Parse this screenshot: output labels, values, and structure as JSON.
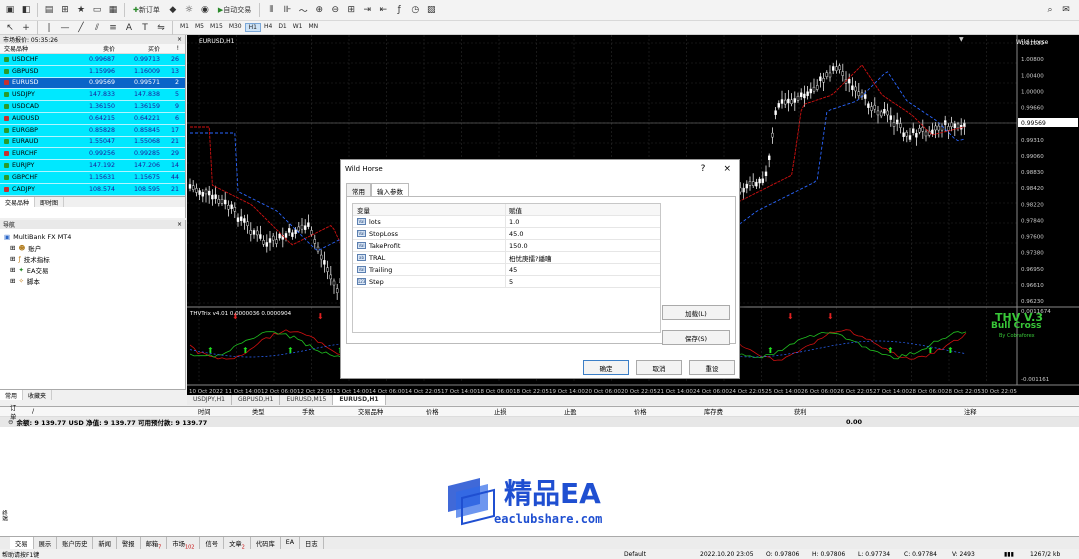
{
  "toolbar": {
    "new_order": "新订单",
    "auto_trade": "自动交易",
    "timeframes": [
      "M1",
      "M5",
      "M15",
      "M30",
      "H1",
      "H4",
      "D1",
      "W1",
      "MN"
    ],
    "active_tf": "H1"
  },
  "market_watch": {
    "title": "市场报价: 05:35:26",
    "headers": {
      "symbol": "交易品种",
      "bid": "卖价",
      "ask": "买价",
      "spread": "!"
    },
    "rows": [
      {
        "symbol": "USDCHF",
        "bid": "0.99687",
        "ask": "0.99713",
        "spread": "26"
      },
      {
        "symbol": "GBPUSD",
        "bid": "1.15996",
        "ask": "1.16009",
        "spread": "13"
      },
      {
        "symbol": "EURUSD",
        "bid": "0.99569",
        "ask": "0.99571",
        "spread": "2"
      },
      {
        "symbol": "USDJPY",
        "bid": "147.833",
        "ask": "147.838",
        "spread": "5"
      },
      {
        "symbol": "USDCAD",
        "bid": "1.36150",
        "ask": "1.36159",
        "spread": "9"
      },
      {
        "symbol": "AUDUSD",
        "bid": "0.64215",
        "ask": "0.64221",
        "spread": "6"
      },
      {
        "symbol": "EURGBP",
        "bid": "0.85828",
        "ask": "0.85845",
        "spread": "17"
      },
      {
        "symbol": "EURAUD",
        "bid": "1.55047",
        "ask": "1.55068",
        "spread": "21"
      },
      {
        "symbol": "EURCHF",
        "bid": "0.99256",
        "ask": "0.99285",
        "spread": "29"
      },
      {
        "symbol": "EURJPY",
        "bid": "147.192",
        "ask": "147.206",
        "spread": "14"
      },
      {
        "symbol": "GBPCHF",
        "bid": "1.15631",
        "ask": "1.15675",
        "spread": "44"
      },
      {
        "symbol": "CADJPY",
        "bid": "108.574",
        "ask": "108.595",
        "spread": "21"
      }
    ],
    "tabs": [
      "交易品种",
      "即时图"
    ]
  },
  "navigator": {
    "title": "导航",
    "root": "MultiBank FX MT4",
    "items": [
      "账户",
      "技术指标",
      "EA交易",
      "脚本"
    ],
    "tabs": [
      "常用",
      "收藏夹"
    ]
  },
  "chart": {
    "symbol_label": "EURUSD,H1",
    "ea_label": "Wild Horse",
    "indicator_label": "THVTrix v4.01 0.0000036 0.0000904",
    "overlay_title": "THV V.3",
    "overlay_sub": "Bull Cross",
    "overlay_brand": "By Cobraforex",
    "price_scale": [
      "1.01030",
      "1.00800",
      "1.00400",
      "1.00000",
      "0.99660",
      "0.99569",
      "0.99310",
      "0.99060",
      "0.98830",
      "0.98420",
      "0.98220",
      "0.97840",
      "0.97600",
      "0.97380",
      "0.96950",
      "0.96610",
      "0.96230"
    ],
    "current_price": "0.99569",
    "ind_scale": [
      "0.0011674",
      "-0.001161"
    ],
    "time_scale": [
      "10 Oct 2022",
      "11 Oct 14:00",
      "12 Oct 06:00",
      "12 Oct 22:05",
      "13 Oct 14:00",
      "14 Oct 06:00",
      "14 Oct 22:05",
      "17 Oct 14:00",
      "18 Oct 06:00",
      "18 Oct 22:05",
      "19 Oct 14:00",
      "20 Oct 06:00",
      "20 Oct 22:05",
      "21 Oct 14:00",
      "24 Oct 06:00",
      "24 Oct 22:05",
      "25 Oct 14:00",
      "26 Oct 06:00",
      "26 Oct 22:05",
      "27 Oct 14:00",
      "28 Oct 06:00",
      "28 Oct 22:05",
      "30 Oct 22:05"
    ],
    "tabs": [
      "USDJPY,H1",
      "GBPUSD,H1",
      "EURUSD,M15",
      "EURUSD,H1"
    ]
  },
  "dialog": {
    "title": "Wild Horse",
    "help": "?",
    "close": "×",
    "tabs": [
      "常用",
      "输入参数"
    ],
    "col_var": "变量",
    "col_val": "赋值",
    "params": [
      {
        "name": "lots",
        "value": "1.0",
        "icon": "Val"
      },
      {
        "name": "StopLoss",
        "value": "45.0",
        "icon": "Val"
      },
      {
        "name": "TakeProfit",
        "value": "150.0",
        "icon": "Val"
      },
      {
        "name": "TRAL",
        "value": "桕忧庚擂?繙嘈",
        "icon": "ab"
      },
      {
        "name": "Trailing",
        "value": "45",
        "icon": "Val"
      },
      {
        "name": "Step",
        "value": "5",
        "icon": "123"
      }
    ],
    "load": "加载(L)",
    "save": "保存(S)",
    "ok": "确定",
    "cancel": "取消",
    "reset": "重设"
  },
  "terminal": {
    "headers": [
      "订单",
      "/",
      "时间",
      "类型",
      "手数",
      "交易品种",
      "价格",
      "止损",
      "止盈",
      "价格",
      "库存费",
      "获利",
      "注释"
    ],
    "balance": "余额: 9 139.77 USD  净值: 9 139.77  可用预付款: 9 139.77",
    "profit": "0.00",
    "tabs": [
      "交易",
      "展示",
      "账户历史",
      "新闻",
      "警报",
      "邮箱",
      "市场",
      "信号",
      "文章",
      "代码库",
      "EA",
      "日志"
    ],
    "badges": {
      "邮箱": "7",
      "市场": "102",
      "文章": "2"
    },
    "side_label": "终端"
  },
  "status": {
    "help": "帮助请按F1键",
    "profile": "Default",
    "datetime": "2022.10.20 23:05",
    "open": "O: 0.97806",
    "high": "H: 0.97806",
    "low": "L: 0.97734",
    "close": "C: 0.97784",
    "volume": "V: 2493",
    "traffic": "1267/2 kb"
  },
  "watermark": {
    "brand": "精品EA",
    "site": "eaclubshare.com"
  },
  "colors": {
    "mw_row": "#00e8ff",
    "mw_sel": "#0a64c8",
    "chart_bg": "#000000",
    "ma_red": "#d01010",
    "ma_blue": "#2a66ff",
    "wm_blue": "#1f4fd1"
  }
}
